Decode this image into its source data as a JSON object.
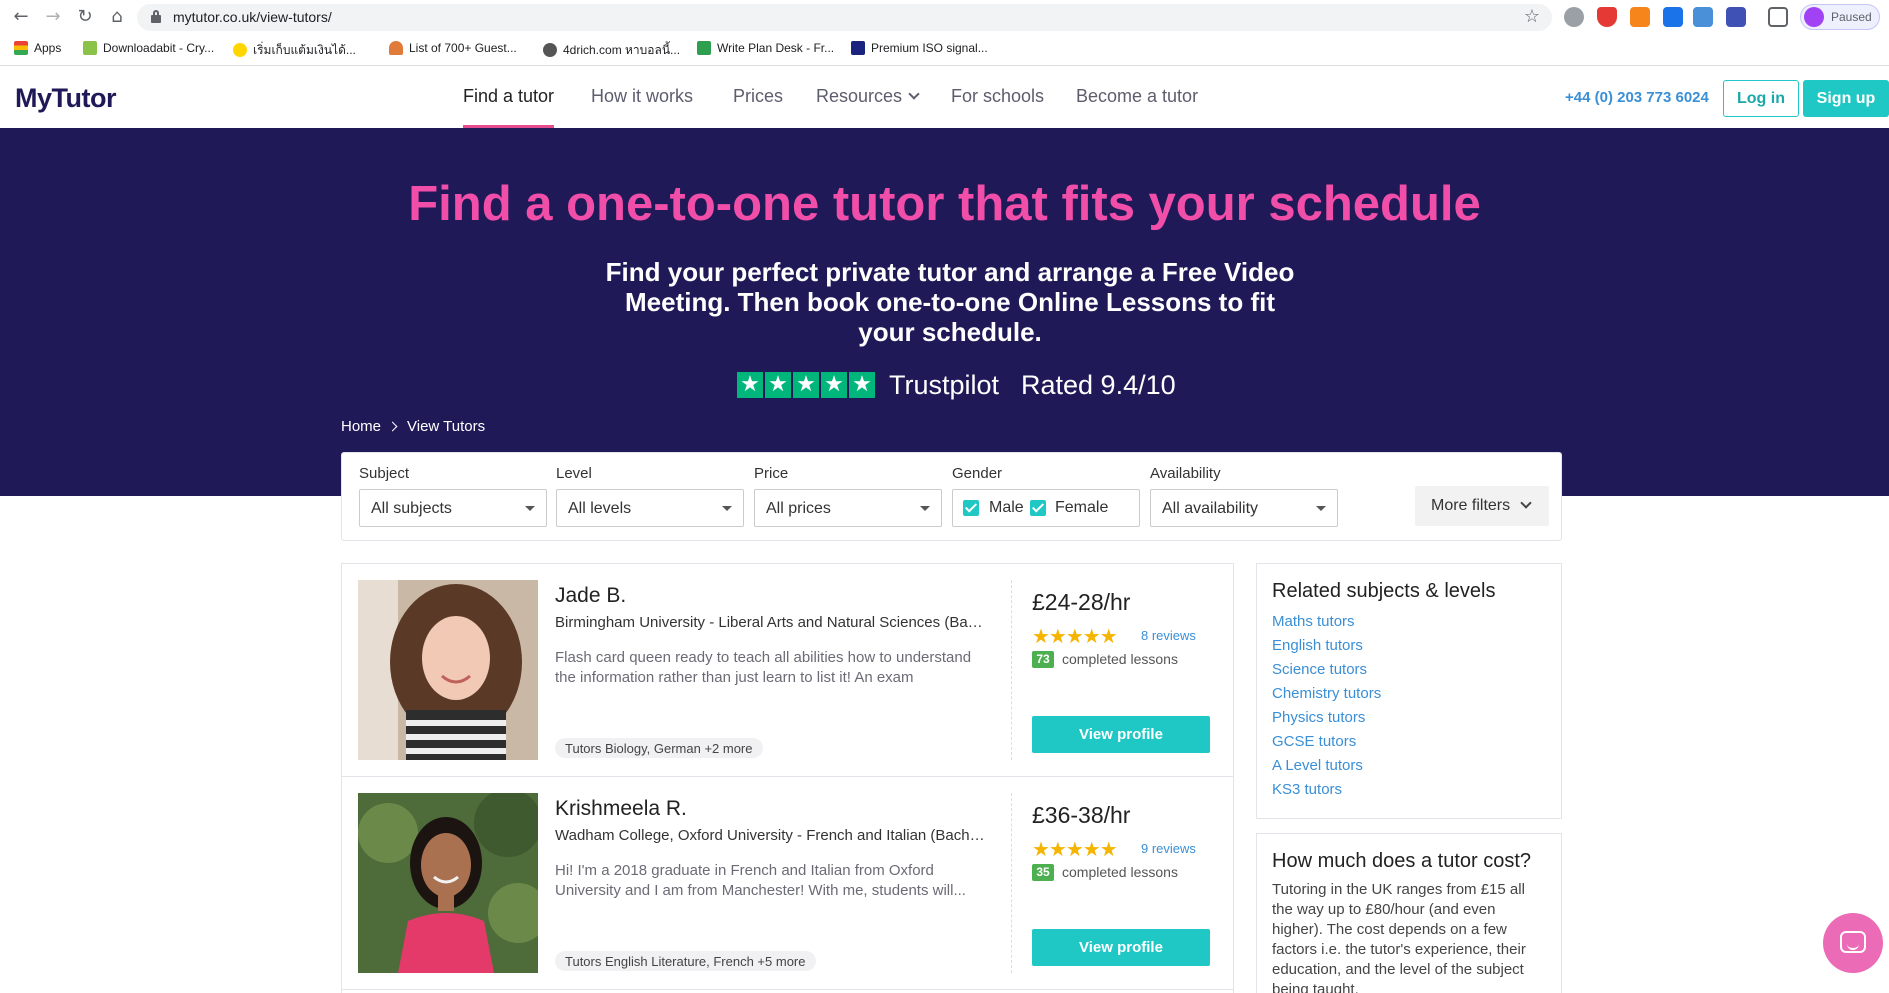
{
  "browser": {
    "url": "mytutor.co.uk/view-tutors/",
    "profile_label": "Paused",
    "bookmarks": [
      "Apps",
      "Downloadabit - Cry...",
      "เริ่มเก็บแต้มเงินได้...",
      "List of 700+ Guest...",
      "4drich.com หาบอลนี้...",
      "Write Plan Desk - Fr...",
      "Premium ISO signal..."
    ]
  },
  "site": {
    "logo": "MyTutor",
    "nav": [
      "Find a tutor",
      "How it works",
      "Prices",
      "Resources",
      "For schools",
      "Become a tutor"
    ],
    "phone": "+44 (0) 203 773 6024",
    "login": "Log in",
    "signup": "Sign up"
  },
  "hero": {
    "title": "Find a one-to-one tutor that fits your schedule",
    "subtitle": "Find your perfect private tutor and arrange a Free Video Meeting. Then book one-to-one Online Lessons to fit your schedule.",
    "trustpilot": "Trustpilot",
    "rated": "Rated 9.4/10",
    "breadcrumb": [
      "Home",
      "View Tutors"
    ]
  },
  "filters": {
    "subject": {
      "label": "Subject",
      "value": "All subjects"
    },
    "level": {
      "label": "Level",
      "value": "All levels"
    },
    "price": {
      "label": "Price",
      "value": "All prices"
    },
    "gender": {
      "label": "Gender",
      "male": "Male",
      "female": "Female"
    },
    "availability": {
      "label": "Availability",
      "value": "All availability"
    },
    "more": "More filters"
  },
  "tutors": [
    {
      "name": "Jade B.",
      "university": "Birmingham University - Liberal Arts and Natural Sciences (Bachelors)",
      "bio": "Flash card queen ready to teach all abilities how to understand the information rather than just learn to list it! An exam",
      "tags": "Tutors Biology, German +2 more",
      "price": "£24-28/hr",
      "reviews": "8 reviews",
      "lessons": "73",
      "lessons_label": "completed lessons",
      "cta": "View profile"
    },
    {
      "name": "Krishmeela R.",
      "university": "Wadham College, Oxford University - French and Italian (Bachelors)",
      "bio": "Hi! I'm a 2018 graduate in French and Italian from Oxford University and I am from Manchester! With me, students will...",
      "tags": "Tutors English Literature, French +5 more",
      "price": "£36-38/hr",
      "reviews": "9 reviews",
      "lessons": "35",
      "lessons_label": "completed lessons",
      "cta": "View profile"
    }
  ],
  "sidebar": {
    "related_title": "Related subjects & levels",
    "related_links": [
      "Maths tutors",
      "English tutors",
      "Science tutors",
      "Chemistry tutors",
      "Physics tutors",
      "GCSE tutors",
      "A Level tutors",
      "KS3 tutors"
    ],
    "cost_title": "How much does a tutor cost?",
    "cost_text": "Tutoring in the UK ranges from £15 all the way up to £80/hour (and even higher). The cost depends on a few factors i.e. the tutor's experience, their education, and the level of the subject being taught."
  },
  "colors": {
    "navy": "#1f1a57",
    "pink": "#f04ea8",
    "teal": "#1fc8c4",
    "link": "#3a8fd6",
    "trustpilot": "#00b67a"
  }
}
